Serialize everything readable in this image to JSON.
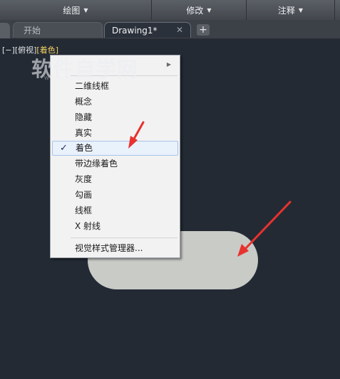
{
  "ribbon": {
    "panels": [
      {
        "label": "绘图"
      },
      {
        "label": "修改"
      },
      {
        "label": "注释"
      }
    ]
  },
  "file_tabs": {
    "start_label": "开始",
    "drawing_label": "Drawing1*",
    "close_glyph": "✕",
    "add_glyph": "+"
  },
  "viewport_controls": {
    "view_control": "[−]",
    "view_name": "[俯视]",
    "visual_style": "[着色]"
  },
  "watermark": {
    "main": "软件自学网",
    "sub": "WWW.RJZXW.COM"
  },
  "context_menu": {
    "items": [
      {
        "label": "二维线框",
        "checked": false
      },
      {
        "label": "概念",
        "checked": false
      },
      {
        "label": "隐藏",
        "checked": false
      },
      {
        "label": "真实",
        "checked": false
      },
      {
        "label": "着色",
        "checked": true
      },
      {
        "label": "带边缘着色",
        "checked": false
      },
      {
        "label": "灰度",
        "checked": false
      },
      {
        "label": "勾画",
        "checked": false
      },
      {
        "label": "线框",
        "checked": false
      },
      {
        "label": "X 射线",
        "checked": false
      }
    ],
    "manager_label": "视觉样式管理器...",
    "check_glyph": "✓",
    "submenu_glyph": "▶"
  },
  "colors": {
    "viewport_bg": "#232a34",
    "active_style": "#f2d060",
    "annotation_arrow": "#e8322e",
    "shaded_object": "#c9cbc7"
  }
}
